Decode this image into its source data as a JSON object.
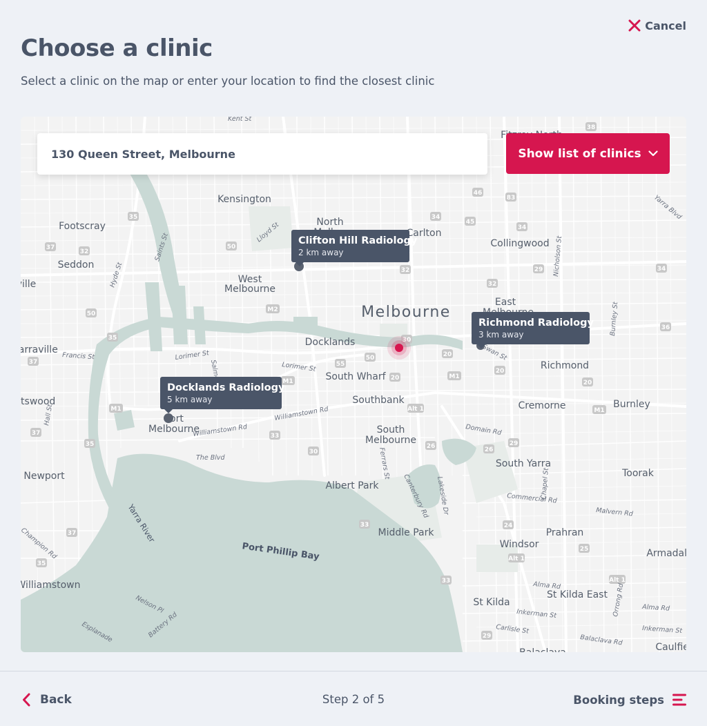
{
  "header": {
    "cancel_label": "Cancel",
    "title": "Choose a clinic",
    "subtitle": "Select a clinic on the map or enter your location to find the closest clinic"
  },
  "search": {
    "value": "130 Queen Street, Melbourne"
  },
  "show_list_label": "Show list of clinics",
  "clinics": [
    {
      "name": "Clifton Hill Radiology",
      "distance": "2 km away"
    },
    {
      "name": "Richmond Radiology",
      "distance": "3 km away"
    },
    {
      "name": "Docklands Radiology",
      "distance": "5 km away"
    }
  ],
  "map": {
    "city_label": "Melbourne",
    "bay_label": "Port Phillip Bay",
    "river_label": "Yarra River",
    "places": [
      "Kensington",
      "North Melbourne",
      "Carlton",
      "Footscray",
      "Seddon",
      "West Melbourne",
      "Collingwood",
      "East Melbourne",
      "Docklands",
      "Richmond",
      "South Wharf",
      "Southbank",
      "Cremorne",
      "Burnley",
      "Port Melbourne",
      "South Melbourne",
      "South Yarra",
      "Toorak",
      "Newport",
      "Albert Park",
      "Middle Park",
      "Windsor",
      "Prahran",
      "Armadale",
      "Williamstown",
      "St Kilda",
      "St Kilda East",
      "Yarraville",
      "Fitzroy North",
      "Spotswood",
      "Caulfield",
      "Balaclava"
    ],
    "streets": [
      "Williamstown Rd",
      "Lorimer St",
      "Francis St",
      "The Blvd",
      "Alma Rd",
      "Inkerman St",
      "Nelson Pl",
      "Esplanade",
      "Battery Rd",
      "Commercial Rd",
      "Malvern Rd",
      "Domain Rd",
      "Swan St",
      "Hyde St",
      "Lloyd St",
      "Canterbury Rd",
      "Ferrars St",
      "Lakeside Dr",
      "Chapel St",
      "Nicholson St",
      "Burnley St",
      "Carlisle St",
      "Balaclava Rd",
      "Orrong Rd",
      "Yarra Blvd",
      "Kent St",
      "Hall St",
      "Champion Rd",
      "Salmon St"
    ],
    "route_badges": [
      "35",
      "37",
      "32",
      "50",
      "M2",
      "M1",
      "55",
      "20",
      "30",
      "Alt 1",
      "33",
      "26",
      "29",
      "24",
      "25",
      "36",
      "34",
      "45",
      "46",
      "83",
      "38",
      "18"
    ]
  },
  "footer": {
    "back_label": "Back",
    "step_label": "Step 2 of 5",
    "booking_steps_label": "Booking steps"
  },
  "colors": {
    "accent": "#d6164f",
    "text": "#4a5568",
    "background": "#eef1f6",
    "water": "#c9d9d5",
    "tooltip": "#4a5568"
  },
  "icons": {
    "cancel": "close-icon",
    "dropdown": "chevron-down-icon",
    "back": "chevron-left-icon",
    "booking_steps": "menu-icon",
    "current_location": "location-dot-icon"
  }
}
